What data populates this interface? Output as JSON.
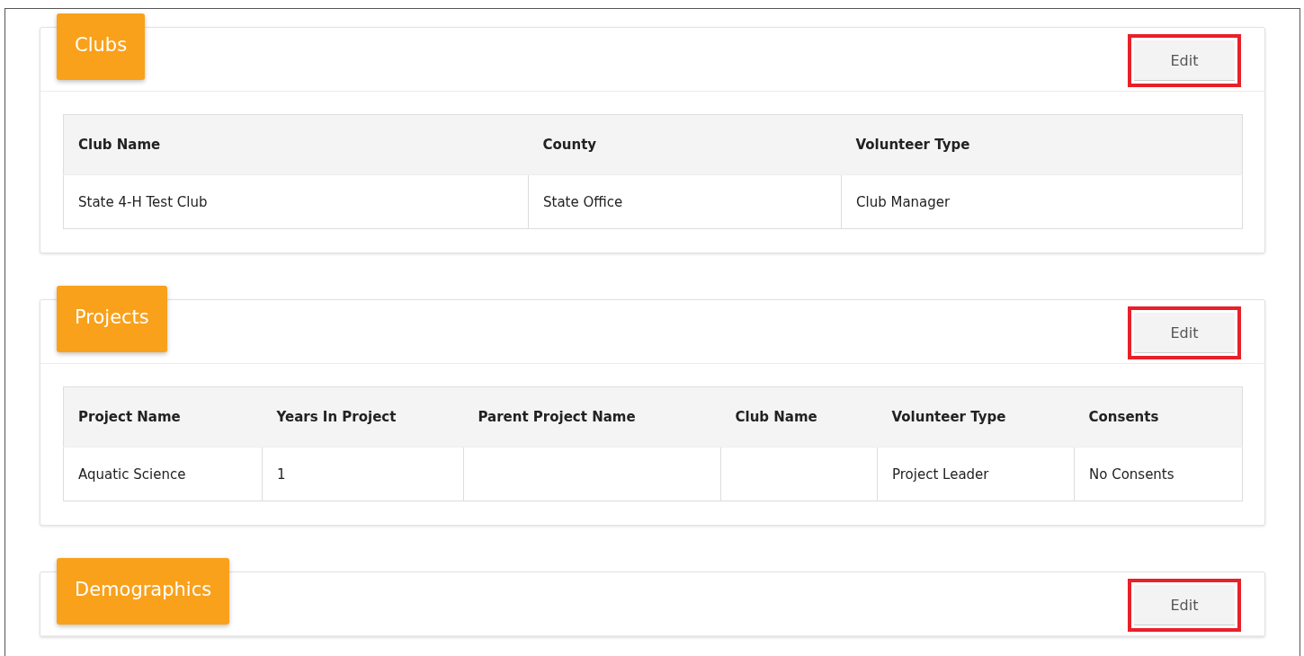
{
  "sections": [
    {
      "title": "Clubs",
      "edit_button": "Edit",
      "highlighted": true,
      "table": {
        "columns": [
          "Club Name",
          "County",
          "Volunteer Type"
        ],
        "rows": [
          [
            "State 4-H Test Club",
            "State Office",
            "Club Manager"
          ]
        ]
      }
    },
    {
      "title": "Projects",
      "edit_button": "Edit",
      "highlighted": true,
      "table": {
        "columns": [
          "Project Name",
          "Years In Project",
          "Parent Project Name",
          "Club Name",
          "Volunteer Type",
          "Consents"
        ],
        "rows": [
          [
            "Aquatic Science",
            "1",
            "",
            "",
            "Project Leader",
            "No Consents"
          ]
        ]
      }
    },
    {
      "title": "Demographics",
      "edit_button": "Edit",
      "highlighted": true
    }
  ]
}
